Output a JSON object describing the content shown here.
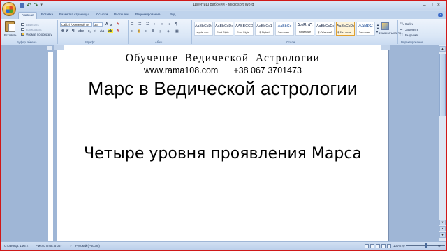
{
  "window": {
    "title": "Дзейтиш рабочий - Microsoft Word",
    "controls": [
      "–",
      "□",
      "×"
    ]
  },
  "tabs": [
    "Главная",
    "Вставка",
    "Разметка страницы",
    "Ссылки",
    "Рассылки",
    "Рецензирование",
    "Вид"
  ],
  "ribbon": {
    "clipboard": {
      "paste": "Вставить",
      "cut": "Вырезать",
      "copy": "Копировать",
      "format_painter": "Формат по образцу",
      "label": "Буфер обмена"
    },
    "font": {
      "name": "Calibri (Основной те",
      "size": "36",
      "label": "Шрифт"
    },
    "paragraph": {
      "label": "Абзац"
    },
    "styles": {
      "items": [
        {
          "sample": "AaBbCcDc",
          "name": "apple-con..."
        },
        {
          "sample": "AaBbCcDc",
          "name": "Font Style..."
        },
        {
          "sample": "AABBCCDI",
          "name": "Font Style..."
        },
        {
          "sample": "AaBbCc1",
          "name": "¶ Styled"
        },
        {
          "sample": "AaBbCc",
          "name": "Заголово..."
        },
        {
          "sample": "AaBbC",
          "name": "Название"
        },
        {
          "sample": "AaBbCcDc",
          "name": "¶ Обычный"
        },
        {
          "sample": "AaBbCcDc",
          "name": "¶ Без инте..."
        },
        {
          "sample": "AaBbC",
          "name": "Заголово..."
        }
      ],
      "change_styles": "Изменить стили",
      "label": "Стили"
    },
    "editing": {
      "find": "Найти",
      "replace": "Заменить",
      "select": "Выделить",
      "label": "Редактирование"
    }
  },
  "document": {
    "header_title": "Обучение Ведической Астрологии",
    "header_site": "www.rama108.com",
    "header_phone": "+38 067 3701473",
    "heading": "Марс в Ведической астрологии",
    "subheading": "Четыре уровня проявления Марса"
  },
  "status": {
    "page": "Страница: 1 из 27",
    "words": "Число слов: 5 067",
    "language": "Русский (Россия)",
    "zoom": "100%"
  }
}
